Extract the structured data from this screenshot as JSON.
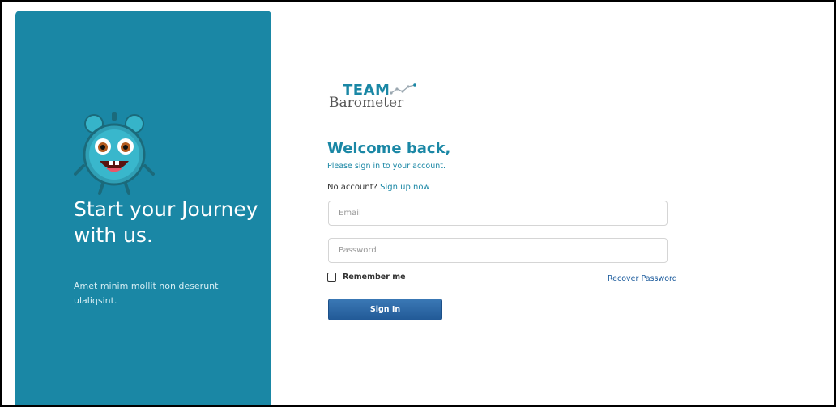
{
  "hero": {
    "title": "Start your Journey with us.",
    "subtitle": "Amet minim mollit non deserunt ulaliqsint."
  },
  "logo": {
    "line1": "TEAM",
    "line2": "Barometer"
  },
  "form": {
    "welcome": "Welcome back,",
    "signin_hint": "Please sign in to your account.",
    "no_account_text": "No account?",
    "signup_link": "Sign up now",
    "email_placeholder": "Email",
    "password_placeholder": "Password",
    "remember_label": "Remember me",
    "recover_link": "Recover Password",
    "signin_button": "Sign In"
  },
  "colors": {
    "brand": "#1a87a5",
    "button": "#2a64a3"
  },
  "icons": {
    "mascot": "alarm-clock-mascot-icon",
    "logo_spark": "trend-line-icon"
  }
}
